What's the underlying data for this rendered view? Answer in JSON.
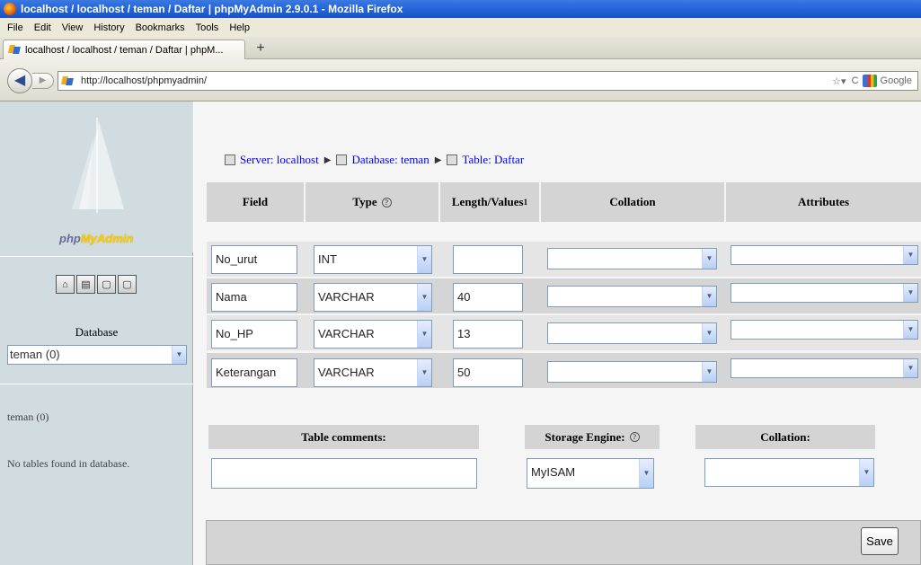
{
  "browser": {
    "window_title": "localhost / localhost / teman / Daftar | phpMyAdmin 2.9.0.1 - Mozilla Firefox",
    "menu": [
      "File",
      "Edit",
      "View",
      "History",
      "Bookmarks",
      "Tools",
      "Help"
    ],
    "tab_title": "localhost / localhost / teman / Daftar | phpM...",
    "new_tab": "+",
    "url": "http://localhost/phpmyadmin/",
    "search_placeholder": "Google"
  },
  "sidebar": {
    "logo_php": "php",
    "logo_myadmin": "MyAdmin",
    "database_label": "Database",
    "database_selected": "teman (0)",
    "db_name": "teman (0)",
    "no_tables": "No tables found in database."
  },
  "breadcrumb": {
    "server": "Server: localhost",
    "database": "Database: teman",
    "table": "Table: Daftar"
  },
  "table": {
    "headers": {
      "field": "Field",
      "type": "Type",
      "length": "Length/Values",
      "length_sup": "1",
      "collation": "Collation",
      "attributes": "Attributes"
    },
    "rows": [
      {
        "field": "No_urut",
        "type": "INT",
        "length": ""
      },
      {
        "field": "Nama",
        "type": "VARCHAR",
        "length": "40"
      },
      {
        "field": "No_HP",
        "type": "VARCHAR",
        "length": "13"
      },
      {
        "field": "Keterangan",
        "type": "VARCHAR",
        "length": "50"
      }
    ]
  },
  "footer": {
    "table_comments_label": "Table comments:",
    "storage_engine_label": "Storage Engine:",
    "storage_engine_value": "MyISAM",
    "collation_label": "Collation:",
    "save_label": "Save"
  }
}
